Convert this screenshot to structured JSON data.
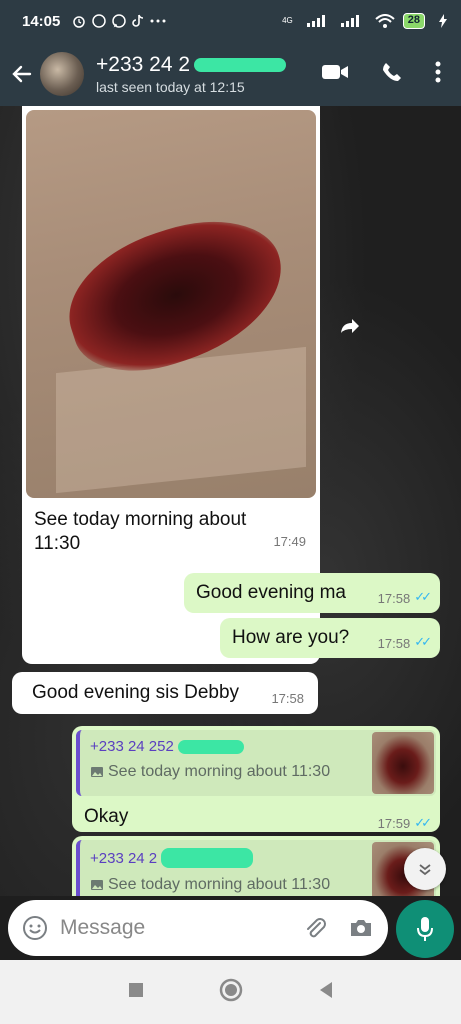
{
  "status_bar": {
    "time": "14:05",
    "network": "4G",
    "battery": "28"
  },
  "header": {
    "contact_name": "+233 24 2",
    "last_seen": "last seen today at 12:15"
  },
  "messages": {
    "image_caption": "See today morning about\n11:30",
    "image_time": "17:49",
    "out1_text": "Good evening ma",
    "out1_time": "17:58",
    "out2_text": "How are you?",
    "out2_time": "17:58",
    "in1_text": "Good evening sis Debby",
    "in1_time": "17:58",
    "reply1": {
      "quoted_name": "+233 24 252",
      "quoted_snippet": "See today morning about 11:30",
      "text": "Okay",
      "time": "17:59"
    },
    "reply2": {
      "quoted_name": "+233 24 2",
      "quoted_snippet": "See today morning about 11:30"
    }
  },
  "composer": {
    "placeholder": "Message"
  },
  "colors": {
    "header_bg": "#2d3b44",
    "outgoing_bubble": "#dcf8c6",
    "incoming_bubble": "#ffffff",
    "accent_green": "#0f8f76",
    "read_ticks": "#34b7f1",
    "redaction": "#3ce6a4"
  },
  "icons": [
    "back-arrow-icon",
    "video-call-icon",
    "voice-call-icon",
    "more-options-icon",
    "forward-icon",
    "emoji-icon",
    "attach-icon",
    "camera-icon",
    "mic-icon",
    "scroll-down-icon",
    "nav-recents-icon",
    "nav-home-icon",
    "nav-back-icon"
  ]
}
